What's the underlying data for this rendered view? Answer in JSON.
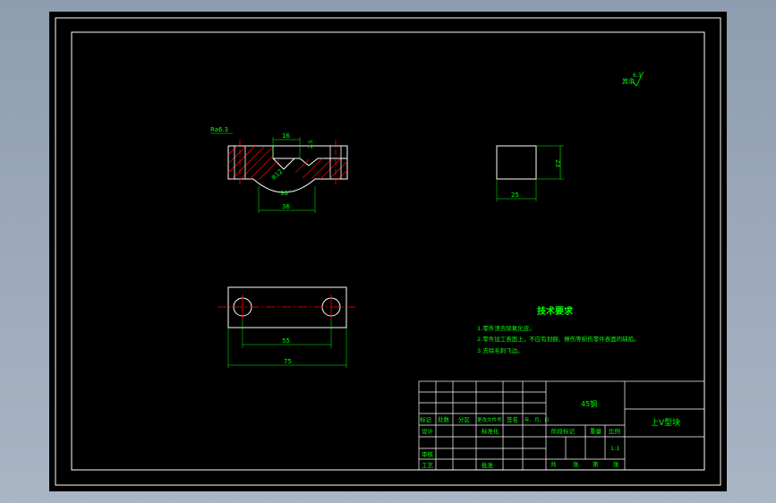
{
  "drawing": {
    "roughness_label": "其余",
    "roughness_value": "6.3",
    "top_view": {
      "surface_label": "Ra6.3",
      "dim_width_top": "16",
      "dim_small": "2.5",
      "dim_radius": "R12",
      "dim_angle": "90°",
      "dim_bottom": "36"
    },
    "side_view": {
      "dim_height": "23",
      "dim_width": "25"
    },
    "bottom_view": {
      "dim_hole_spacing": "55",
      "dim_total": "75"
    },
    "technical_requirements": {
      "title": "技术要求",
      "items": [
        "1.零件须去除氧化皮。",
        "2.零件加工表面上，不应有划痕、擦伤等损伤零件表面的缺陷。",
        "3.去除毛刺飞边。"
      ]
    },
    "title_block": {
      "material": "45钢",
      "part_name": "上V型块",
      "row_labels": [
        "标记",
        "处数",
        "分区",
        "更改文件号",
        "签名",
        "年、月、日"
      ],
      "design": "设计",
      "standardization": "标准化",
      "review": "审核",
      "process": "工艺",
      "approve": "批准",
      "stage_mark": "阶段标记",
      "weight": "重量",
      "scale": "比例",
      "scale_value": "1:1",
      "sheet_info": [
        "共",
        "张",
        "第",
        "张"
      ]
    }
  },
  "colors": {
    "background": "#000000",
    "line": "#ffffff",
    "dimension": "#00ff00",
    "center": "#ff0000",
    "hatch": "#ff0000",
    "text": "#00ff00"
  }
}
